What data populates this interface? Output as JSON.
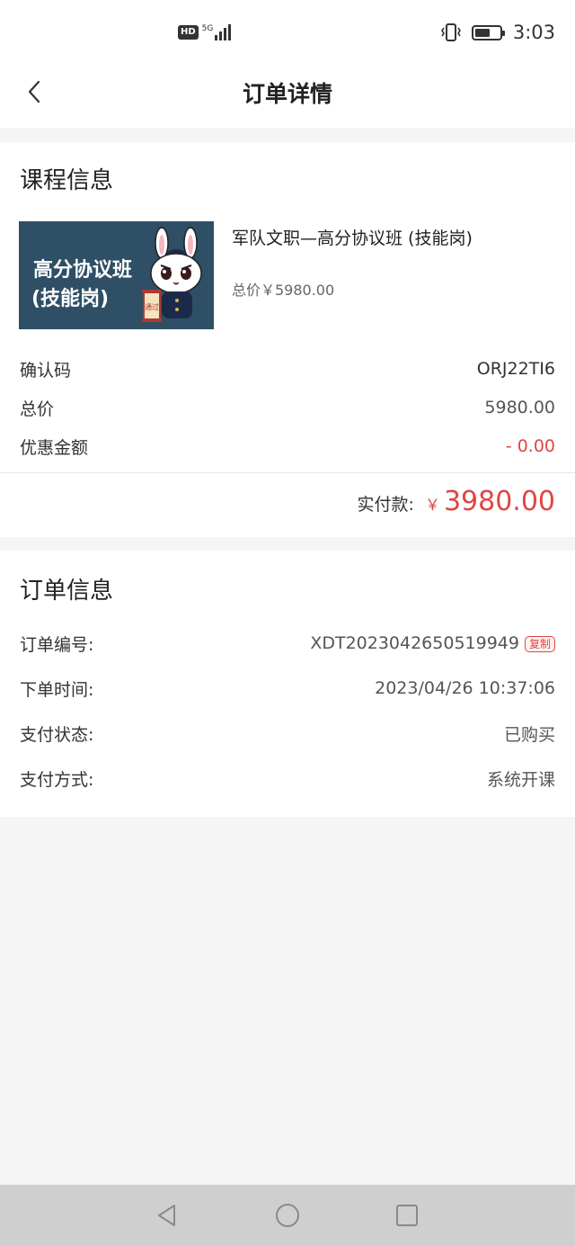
{
  "status_bar": {
    "hd": "HD",
    "network": "5G",
    "time": "3:03"
  },
  "header": {
    "title": "订单详情"
  },
  "course_section": {
    "title": "课程信息",
    "thumbnail": {
      "line1": "高分协议班",
      "line2": "(技能岗)",
      "seal_text": "通过"
    },
    "course_name": "军队文职—高分协议班 (技能岗)",
    "course_price": "总价￥5980.00",
    "rows": [
      {
        "label": "确认码",
        "value": "ORJ22TI6"
      },
      {
        "label": "总价",
        "value": "5980.00"
      },
      {
        "label": "优惠金额",
        "value": "- 0.00"
      }
    ],
    "paid_label": "实付款:",
    "paid_currency": "￥",
    "paid_amount": "3980.00"
  },
  "order_section": {
    "title": "订单信息",
    "rows": [
      {
        "label": "订单编号:",
        "value": "XDT2023042650519949"
      },
      {
        "label": "下单时间:",
        "value": "2023/04/26 10:37:06"
      },
      {
        "label": "支付状态:",
        "value": "已购买"
      },
      {
        "label": "支付方式:",
        "value": "系统开课"
      }
    ],
    "copy_label": "复制"
  },
  "colors": {
    "accent_red": "#e04545",
    "thumb_bg": "#2e4f66"
  }
}
